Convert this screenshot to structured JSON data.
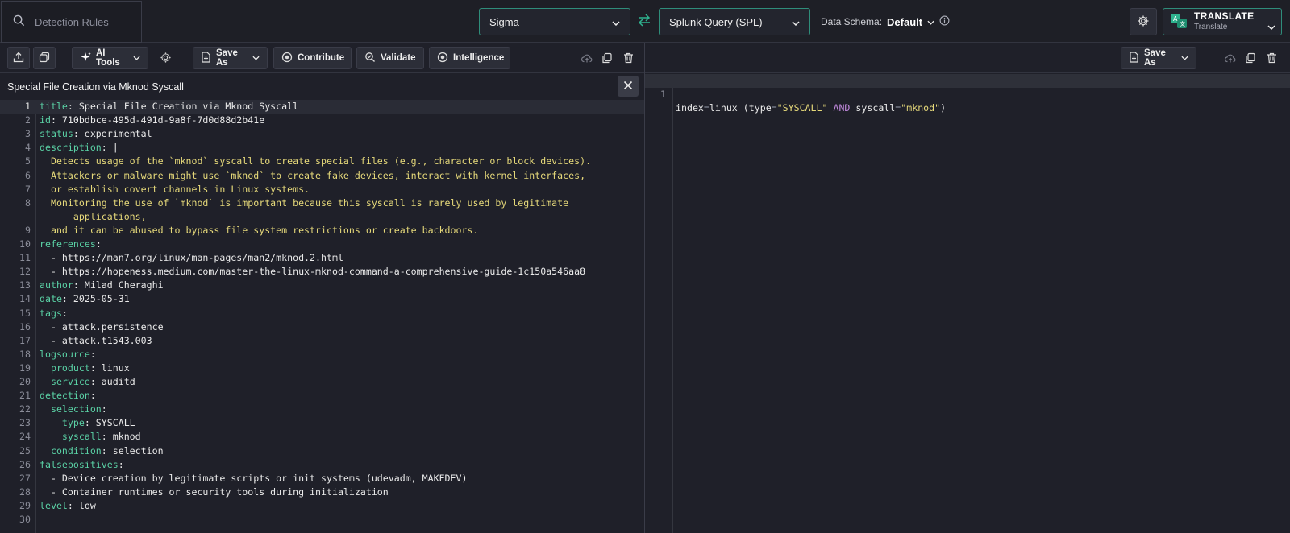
{
  "search": {
    "placeholder": "Detection Rules",
    "icon": "search-icon"
  },
  "source_select": {
    "value": "Sigma"
  },
  "target_select": {
    "value": "Splunk Query (SPL)"
  },
  "schema": {
    "label": "Data Schema:",
    "value": "Default"
  },
  "translate": {
    "title": "TRANSLATE",
    "subtitle": "Translate"
  },
  "toolbar_left": {
    "ai_tools": "AI Tools",
    "save_as": "Save As",
    "contribute": "Contribute",
    "validate": "Validate",
    "intelligence": "Intelligence"
  },
  "toolbar_right": {
    "save_as": "Save As"
  },
  "rule_title": "Special File Creation via Mknod Syscall",
  "source_lines": [
    {
      "n": "1",
      "k": "title",
      "v": ": Special File Creation via Mknod Syscall",
      "cls": "",
      "active": true
    },
    {
      "n": "2",
      "k": "id",
      "v": ": 710bdbce-495d-491d-9a8f-7d0d88d2b41e",
      "cls": ""
    },
    {
      "n": "3",
      "k": "status",
      "v": ": experimental",
      "cls": ""
    },
    {
      "n": "4",
      "k": "description",
      "v": ": |",
      "cls": ""
    },
    {
      "n": "5",
      "k": "",
      "v": "  Detects usage of the `mknod` syscall to create special files (e.g., character or block devices).",
      "cls": "y"
    },
    {
      "n": "6",
      "k": "",
      "v": "  Attackers or malware might use `mknod` to create fake devices, interact with kernel interfaces,",
      "cls": "y"
    },
    {
      "n": "7",
      "k": "",
      "v": "  or establish covert channels in Linux systems.",
      "cls": "y"
    },
    {
      "n": "8",
      "k": "",
      "v": "  Monitoring the use of `mknod` is important because this syscall is rarely used by legitimate",
      "cls": "y"
    },
    {
      "n": "",
      "k": "",
      "v": "      applications,",
      "cls": "y"
    },
    {
      "n": "9",
      "k": "",
      "v": "  and it can be abused to bypass file system restrictions or create backdoors.",
      "cls": "y"
    },
    {
      "n": "10",
      "k": "references",
      "v": ":",
      "cls": ""
    },
    {
      "n": "11",
      "k": "",
      "v": "  - https://man7.org/linux/man-pages/man2/mknod.2.html",
      "cls": ""
    },
    {
      "n": "12",
      "k": "",
      "v": "  - https://hopeness.medium.com/master-the-linux-mknod-command-a-comprehensive-guide-1c150a546aa8",
      "cls": ""
    },
    {
      "n": "13",
      "k": "author",
      "v": ": Milad Cheraghi",
      "cls": ""
    },
    {
      "n": "14",
      "k": "date",
      "v": ": 2025-05-31",
      "cls": ""
    },
    {
      "n": "15",
      "k": "tags",
      "v": ":",
      "cls": ""
    },
    {
      "n": "16",
      "k": "",
      "v": "  - attack.persistence",
      "cls": ""
    },
    {
      "n": "17",
      "k": "",
      "v": "  - attack.t1543.003",
      "cls": ""
    },
    {
      "n": "18",
      "k": "logsource",
      "v": ":",
      "cls": ""
    },
    {
      "n": "19",
      "k": "  product",
      "v": ": linux",
      "cls": ""
    },
    {
      "n": "20",
      "k": "  service",
      "v": ": auditd",
      "cls": ""
    },
    {
      "n": "21",
      "k": "detection",
      "v": ":",
      "cls": ""
    },
    {
      "n": "22",
      "k": "  selection",
      "v": ":",
      "cls": ""
    },
    {
      "n": "23",
      "k": "    type",
      "v": ": SYSCALL",
      "cls": ""
    },
    {
      "n": "24",
      "k": "    syscall",
      "v": ": mknod",
      "cls": ""
    },
    {
      "n": "25",
      "k": "  condition",
      "v": ": selection",
      "cls": ""
    },
    {
      "n": "26",
      "k": "falsepositives",
      "v": ":",
      "cls": ""
    },
    {
      "n": "27",
      "k": "",
      "v": "  - Device creation by legitimate scripts or init systems (udevadm, MAKEDEV)",
      "cls": ""
    },
    {
      "n": "28",
      "k": "",
      "v": "  - Container runtimes or security tools during initialization",
      "cls": ""
    },
    {
      "n": "29",
      "k": "level",
      "v": ": low",
      "cls": ""
    },
    {
      "n": "30",
      "k": "",
      "v": "",
      "cls": ""
    }
  ],
  "output": {
    "line_number": "1",
    "tokens": [
      {
        "t": "index",
        "c": ""
      },
      {
        "t": "=",
        "c": "op"
      },
      {
        "t": "linux (type",
        "c": ""
      },
      {
        "t": "=",
        "c": "op"
      },
      {
        "t": "\"SYSCALL\"",
        "c": "s"
      },
      {
        "t": " ",
        "c": ""
      },
      {
        "t": "AND",
        "c": "kw"
      },
      {
        "t": " syscall",
        "c": ""
      },
      {
        "t": "=",
        "c": "op"
      },
      {
        "t": "\"mknod\"",
        "c": "s"
      },
      {
        "t": ")",
        "c": ""
      }
    ]
  },
  "colors": {
    "accent": "#2fb38f",
    "key": "#5ad1a5",
    "string": "#e6d97a",
    "keyword": "#c48be0"
  }
}
